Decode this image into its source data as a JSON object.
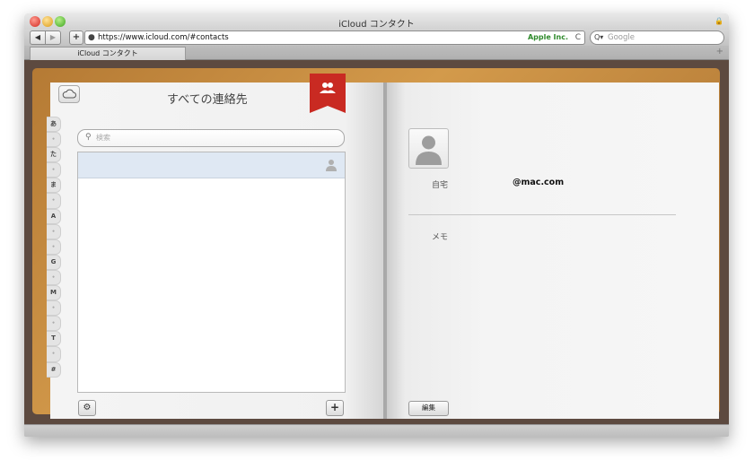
{
  "window": {
    "title": "iCloud コンタクト"
  },
  "toolbar": {
    "back_label": "◀",
    "forward_label": "▶",
    "add_label": "+",
    "url": "https://www.icloud.com/#contacts",
    "cert_label": "Apple Inc.",
    "reload_label": "C",
    "search_placeholder": "Google"
  },
  "tabs": [
    {
      "label": "iCloud コンタクト"
    }
  ],
  "contacts": {
    "title": "すべての連絡先",
    "search_placeholder": "検索",
    "index": [
      "あ",
      "•",
      "た",
      "•",
      "ま",
      "•",
      "A",
      "•",
      "•",
      "G",
      "•",
      "M",
      "•",
      "•",
      "T",
      "•",
      "#"
    ]
  },
  "detail": {
    "home_label": "自宅",
    "email": "@mac.com",
    "memo_label": "メモ",
    "edit_label": "編集"
  },
  "colors": {
    "bookmark": "#c92a22",
    "selected_row": "#dfe8f3",
    "cover": "#c68b3f"
  },
  "icons": [
    "cloud-icon",
    "group-icon",
    "search-icon",
    "person-icon",
    "gear-icon",
    "plus-icon"
  ]
}
